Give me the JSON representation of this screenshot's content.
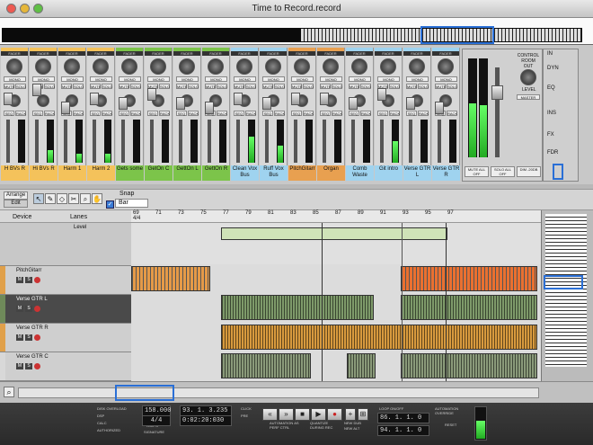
{
  "window": {
    "title": "Time to Record.record"
  },
  "mixer": {
    "channels": [
      {
        "name": "H BVs R",
        "color": "#f4c25b"
      },
      {
        "name": "Hi BVs R",
        "color": "#f4c25b"
      },
      {
        "name": "Harm 1",
        "color": "#f4c25b"
      },
      {
        "name": "Harm 2",
        "color": "#f4c25b"
      },
      {
        "name": "Gets some",
        "color": "#7cc44a"
      },
      {
        "name": "GetOn C",
        "color": "#7cc44a"
      },
      {
        "name": "GettOn L",
        "color": "#7cc44a"
      },
      {
        "name": "GettOn R",
        "color": "#7cc44a"
      },
      {
        "name": "Clean Vox Bus",
        "color": "#9fd3ef"
      },
      {
        "name": "Ruff Vox Bus",
        "color": "#9fd3ef"
      },
      {
        "name": "PitchGitarr",
        "color": "#e8a050"
      },
      {
        "name": "Organ",
        "color": "#e8a050"
      },
      {
        "name": "Comb Waste",
        "color": "#9fd3ef"
      },
      {
        "name": "Git intro",
        "color": "#9fd3ef"
      },
      {
        "name": "Verse GTR L",
        "color": "#9fd3ef"
      },
      {
        "name": "Verse GTR R",
        "color": "#9fd3ef"
      }
    ],
    "strip_labels": {
      "fader": "FADER",
      "mono": "MONO",
      "solo": "SOLO",
      "mute": "MUTE",
      "rack": "RACK",
      "seq": "SEQ"
    },
    "master": {
      "control_room_out": "CONTROL ROOM OUT",
      "level": "LEVEL",
      "master_label": "MASTER",
      "mute_all_off": "MUTE ALL OFF",
      "solo_all_off": "SOLO ALL OFF",
      "dim": "DIM -20DB"
    },
    "nav": [
      "IN",
      "DYN",
      "EQ",
      "INS",
      "FX",
      "FDR"
    ]
  },
  "toolbar": {
    "arrange_label": "Arrange",
    "edit_label": "Edit",
    "snap_label": "Snap",
    "snap_value": "Bar"
  },
  "tracks": {
    "header": {
      "device": "Device",
      "lanes": "Lanes"
    },
    "rows": [
      {
        "name": "Level",
        "kind": "automation"
      },
      {
        "name": "PitchGitarr",
        "kind": "instrument"
      },
      {
        "name": "Verse GTR L",
        "kind": "audio"
      },
      {
        "name": "Verse GTR R",
        "kind": "audio"
      },
      {
        "name": "Verse GTR C",
        "kind": "audio"
      }
    ]
  },
  "ruler": {
    "bars": [
      "69",
      "71",
      "73",
      "75",
      "77",
      "79",
      "81",
      "83",
      "85",
      "87",
      "89",
      "91",
      "93",
      "95",
      "97"
    ],
    "timesig": "4/4"
  },
  "transport": {
    "status_labels": [
      "DISK OVERLOAD",
      "DSP",
      "CALC",
      "AUTHORIZED"
    ],
    "tempo": "158.000",
    "signature": "4/4",
    "position": "93. 1. 3.235",
    "time": "0:02:20:030",
    "loop_left": "86. 1. 1.   0",
    "loop_right": "94. 1. 1.   0",
    "labels": {
      "tempo": "TEMPO",
      "signature": "SIGNATURE",
      "loop": "LOOP ON/OFF",
      "click": "CLICK",
      "pre": "PRE",
      "automation": "AUTOMATION AS PERF CTRL",
      "quantize": "QUANTIZE DURING REC",
      "new_dub": "NEW DUB",
      "new_alt": "NEW ALT",
      "reset": "RESET",
      "automation_override": "AUTOMATION OVERRIDE"
    }
  },
  "colors": {
    "accent": "#2a6fd6"
  }
}
